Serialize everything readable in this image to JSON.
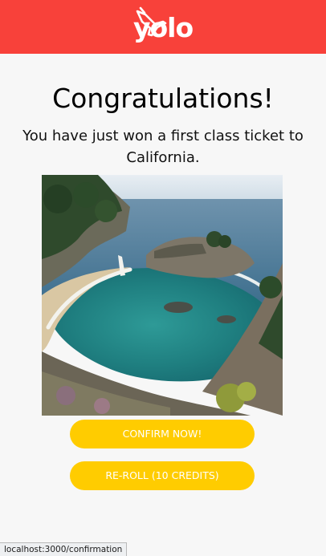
{
  "header": {
    "logo_text": "yolo",
    "brand_color": "#f8413a"
  },
  "main": {
    "title": "Congratulations!",
    "message": "You have just won a first class ticket to California.",
    "image_alt": "Coastal cove with turquoise water and a waterfall onto a sandy beach",
    "confirm_button": "CONFIRM NOW!",
    "reroll_button": "RE-ROLL (10 CREDITS)",
    "button_color": "#ffcc00"
  },
  "status": {
    "url": "localhost:3000/confirmation"
  }
}
